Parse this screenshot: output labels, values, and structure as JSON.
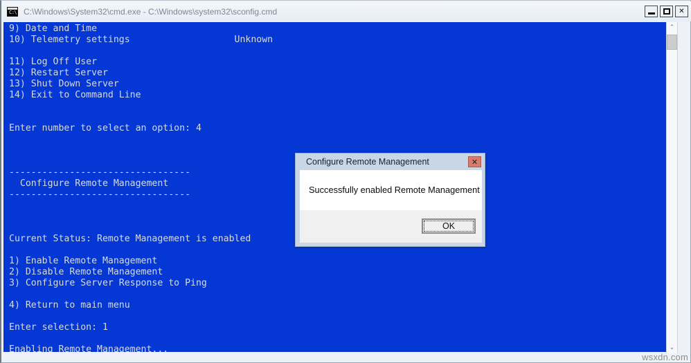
{
  "window": {
    "title": "C:\\Windows\\System32\\cmd.exe - C:\\Windows\\system32\\sconfig.cmd",
    "icon": "cmd-console-icon",
    "icon_glyph": "C:\\",
    "controls": {
      "minimize_label": "–",
      "maximize_label": "□",
      "close_label": "✕"
    }
  },
  "console": {
    "background_color": "#0437d4",
    "text_color": "#d5dbe3",
    "content": "9) Date and Time\n10) Telemetry settings                   Unknown\n\n11) Log Off User\n12) Restart Server\n13) Shut Down Server\n14) Exit to Command Line\n\n\nEnter number to select an option: 4\n\n\n\n---------------------------------\n  Configure Remote Management\n---------------------------------\n\n\n\nCurrent Status: Remote Management is enabled\n\n1) Enable Remote Management\n2) Disable Remote Management\n3) Configure Server Response to Ping\n\n4) Return to main menu\n\nEnter selection: 1\n\nEnabling Remote Management...",
    "lines": [
      "9) Date and Time",
      "10) Telemetry settings                   Unknown",
      "",
      "11) Log Off User",
      "12) Restart Server",
      "13) Shut Down Server",
      "14) Exit to Command Line",
      "",
      "",
      "Enter number to select an option: 4",
      "",
      "",
      "",
      "---------------------------------",
      "  Configure Remote Management",
      "---------------------------------",
      "",
      "",
      "",
      "Current Status: Remote Management is enabled",
      "",
      "1) Enable Remote Management",
      "2) Disable Remote Management",
      "3) Configure Server Response to Ping",
      "",
      "4) Return to main menu",
      "",
      "Enter selection: 1",
      "",
      "Enabling Remote Management..."
    ]
  },
  "scrollbar": {
    "up_arrow": "⌃",
    "down_arrow": "⌄"
  },
  "dialog": {
    "title": "Configure Remote Management",
    "close_label": "✕",
    "message": "Successfully enabled Remote Management",
    "ok_label": "OK",
    "titlebar_color": "#c8d6e5",
    "close_button_color": "#d97b6c"
  },
  "watermark": {
    "text": "wsxdn.com"
  }
}
